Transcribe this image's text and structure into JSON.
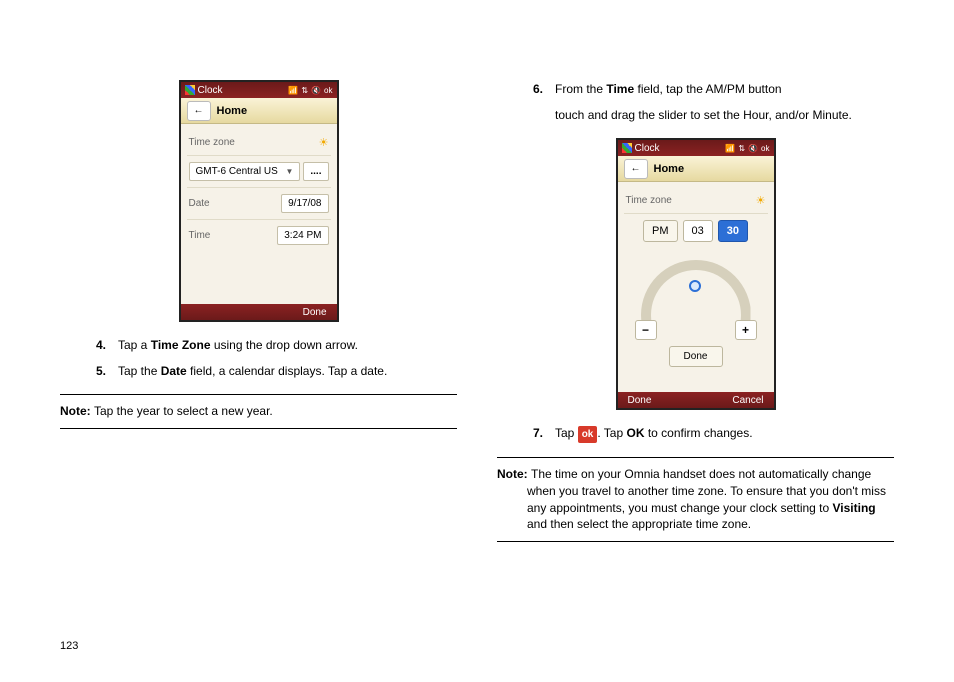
{
  "page_number": "123",
  "phone1": {
    "status_title": "Clock",
    "status_ok": "ok",
    "header_title": "Home",
    "back_glyph": "←",
    "label_timezone": "Time zone",
    "value_timezone": "GMT-6 Central US",
    "label_date": "Date",
    "value_date": "9/17/08",
    "label_time": "Time",
    "value_time": "3:24 PM",
    "ellipsis": "....",
    "footer_done": "Done",
    "sun_glyph": "☀",
    "dropdown_glyph": "▼"
  },
  "phone2": {
    "status_title": "Clock",
    "status_ok": "ok",
    "header_title": "Home",
    "back_glyph": "←",
    "label_timezone": "Time zone",
    "pm": "PM",
    "hour": "03",
    "minute": "30",
    "minus": "−",
    "plus": "+",
    "inner_done": "Done",
    "footer_done": "Done",
    "footer_cancel": "Cancel",
    "sun_glyph": "☀"
  },
  "left_steps": {
    "s4_num": "4.",
    "s4_a": "Tap a ",
    "s4_b": "Time Zone",
    "s4_c": " using the drop down arrow.",
    "s5_num": "5.",
    "s5_a": "Tap the ",
    "s5_b": "Date",
    "s5_c": " field, a calendar displays. Tap a date."
  },
  "left_note": {
    "label": "Note: ",
    "text": "Tap the year to select a new year."
  },
  "right_steps": {
    "s6_num": "6.",
    "s6_a": "From the ",
    "s6_b": "Time",
    "s6_c": " field, tap the AM/PM button",
    "s6_cont": "touch and drag the slider to set the Hour, and/or Minute.",
    "s7_num": "7.",
    "s7_a": "Tap ",
    "s7_ok": "ok",
    "s7_b": ". Tap ",
    "s7_c": "OK",
    "s7_d": " to confirm changes."
  },
  "right_note": {
    "label": "Note: ",
    "t1": "The time on your Omnia handset does not automatically change when you travel to another time zone. To ensure that you don't miss any appointments, you must change your clock setting to ",
    "bold": "Visiting",
    "t2": " and then select the appropriate time zone."
  }
}
